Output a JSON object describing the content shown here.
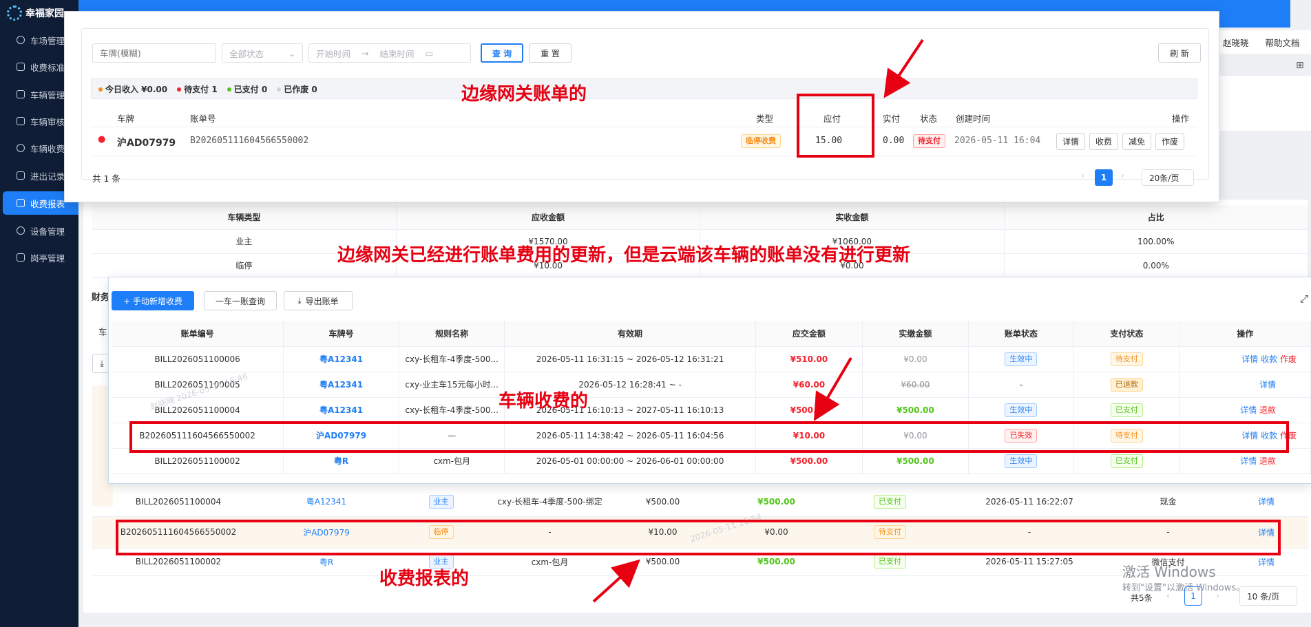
{
  "app": {
    "name": "幸福家园"
  },
  "nav": [
    {
      "label": "车场管理",
      "icon": "gear-icon"
    },
    {
      "label": "收费标准",
      "icon": "fee-standard-icon"
    },
    {
      "label": "车辆管理",
      "icon": "car-icon"
    },
    {
      "label": "车辆审核",
      "icon": "audit-icon"
    },
    {
      "label": "车辆收费",
      "icon": "coin-icon"
    },
    {
      "label": "进出记录",
      "icon": "record-icon"
    },
    {
      "label": "收费报表",
      "icon": "report-icon"
    },
    {
      "label": "设备管理",
      "icon": "device-icon"
    },
    {
      "label": "岗亭管理",
      "icon": "booth-icon"
    }
  ],
  "header": {
    "user": "赵晓晓",
    "help": "帮助文档"
  },
  "gateway": {
    "search_placeholder": "车牌(模糊)",
    "status_select": "全部状态",
    "start_placeholder": "开始时间",
    "range_sep": "→",
    "end_placeholder": "结束时间",
    "query_label": "查 询",
    "reset_label": "重 置",
    "refresh_label": "刷 新",
    "stats": {
      "today_income": "今日收入 ¥0.00",
      "pending": "待支付 1",
      "paid": "已支付 0",
      "voided": "已作废 0"
    },
    "columns": {
      "plate": "车牌",
      "bill_no": "账单号",
      "type": "类型",
      "payable": "应付",
      "paid": "实付",
      "status": "状态",
      "created": "创建时间",
      "actions": "操作"
    },
    "row": {
      "plate": "沪AD07979",
      "bill_no": "B202605111604566550002",
      "type": "临停收费",
      "payable": "15.00",
      "paid": "0.00",
      "status": "待支付",
      "created": "2026-05-11 16:04"
    },
    "row_actions": [
      "详情",
      "收费",
      "减免",
      "作废"
    ],
    "total": "共 1 条",
    "pager": {
      "prev": "‹",
      "current": "1",
      "next": "›",
      "page_size": "20条/页"
    }
  },
  "summary": {
    "columns": [
      "车辆类型",
      "应收金额",
      "实收金额",
      "占比"
    ],
    "rows": [
      [
        "业主",
        "¥1570.00",
        "¥1060.00",
        "100.00%"
      ],
      [
        "临停",
        "¥10.00",
        "¥0.00",
        "0.00%"
      ]
    ]
  },
  "finance": {
    "title_fragment": "财务",
    "filter_fragment": "车",
    "icon_fragment": "⤓"
  },
  "vehicle_fees": {
    "buttons": {
      "add": "+ 手动新增收费",
      "lookup": "一车一账查询",
      "export": "导出账单"
    },
    "columns": [
      "账单编号",
      "车牌号",
      "规则名称",
      "有效期",
      "应交金额",
      "实缴金额",
      "账单状态",
      "支付状态",
      "操作"
    ],
    "rows": [
      {
        "bill_no": "BILL2026051100006",
        "plate": "粤A12341",
        "rule": "cxy-长租车-4季度-500...",
        "period": "2026-05-11 16:31:15 ~ 2026-05-12 16:31:21",
        "due": "¥510.00",
        "paid": "¥0.00",
        "bill_status": "生效中",
        "pay_status": "待支付",
        "actions": [
          "详情",
          "收款",
          "作废"
        ]
      },
      {
        "bill_no": "BILL2026051100005",
        "plate": "粤A12341",
        "rule": "cxy-业主车15元每小时...",
        "period": "2026-05-12 16:28:41 ~ -",
        "due": "¥60.00",
        "paid": "¥60.00",
        "bill_status": "-",
        "pay_status": "已退款",
        "actions": [
          "详情"
        ]
      },
      {
        "bill_no": "BILL2026051100004",
        "plate": "粤A12341",
        "rule": "cxy-长租车-4季度-500...",
        "period": "2026-05-11 16:10:13 ~ 2027-05-11 16:10:13",
        "due": "¥500.00",
        "paid": "¥500.00",
        "bill_status": "生效中",
        "pay_status": "已支付",
        "actions": [
          "详情",
          "退款"
        ]
      },
      {
        "bill_no": "B202605111604566550002",
        "plate": "沪AD07979",
        "rule": "—",
        "period": "2026-05-11 14:38:42 ~ 2026-05-11 16:04:56",
        "due": "¥10.00",
        "paid": "¥0.00",
        "bill_status": "已失效",
        "pay_status": "待支付",
        "actions": [
          "详情",
          "收款",
          "作废"
        ]
      },
      {
        "bill_no": "BILL2026051100002",
        "plate": "粤R",
        "rule": "cxm-包月",
        "period": "2026-05-01 00:00:00 ~ 2026-06-01 00:00:00",
        "due": "¥500.00",
        "paid": "¥500.00",
        "bill_status": "生效中",
        "pay_status": "已支付",
        "actions": [
          "详情",
          "退款"
        ]
      }
    ]
  },
  "report": {
    "rows": [
      {
        "bill_no": "BILL2026051100004",
        "plate": "粤A12341",
        "type": "业主",
        "rule": "cxy-长租车-4季度-500-绑定",
        "due": "¥500.00",
        "paid": "¥500.00",
        "status": "已支付",
        "time": "2026-05-11 16:22:07",
        "method": "现金",
        "action": "详情"
      },
      {
        "bill_no": "B202605111604566550002",
        "plate": "沪AD07979",
        "type": "临停",
        "rule": "-",
        "due": "¥10.00",
        "paid": "¥0.00",
        "status": "待支付",
        "time": "-",
        "method": "-",
        "action": "详情"
      },
      {
        "bill_no": "BILL2026051100002",
        "plate": "粤R",
        "type": "业主",
        "rule": "cxm-包月",
        "due": "¥500.00",
        "paid": "¥500.00",
        "status": "已支付",
        "time": "2026-05-11 15:27:05",
        "method": "微信支付",
        "action": "详情"
      }
    ],
    "total": "共5条",
    "pager": {
      "prev": "‹",
      "current": "1",
      "next": "›",
      "page_size": "10 条/页"
    }
  },
  "annotations": {
    "gateway": "边缘网关账单的",
    "not_synced": "边缘网关已经进行账单费用的更新，但是云端该车辆的账单没有进行更新",
    "vehicle_fee": "车辆收费的",
    "report": "收费报表的"
  },
  "watermarks": {
    "activate": "激活 Windows",
    "activate_hint": "转到\"设置\"以激活 Windows。",
    "user_stamp": "赵晓晓 2026-05-11 16:46",
    "user_stamp2": "2026-05-11 16:54"
  },
  "colors": {
    "primary": "#1e7ef7",
    "sidebar": "#0f1d36",
    "annotation": "#e60012",
    "danger": "#f5222d",
    "success": "#52c41a"
  }
}
